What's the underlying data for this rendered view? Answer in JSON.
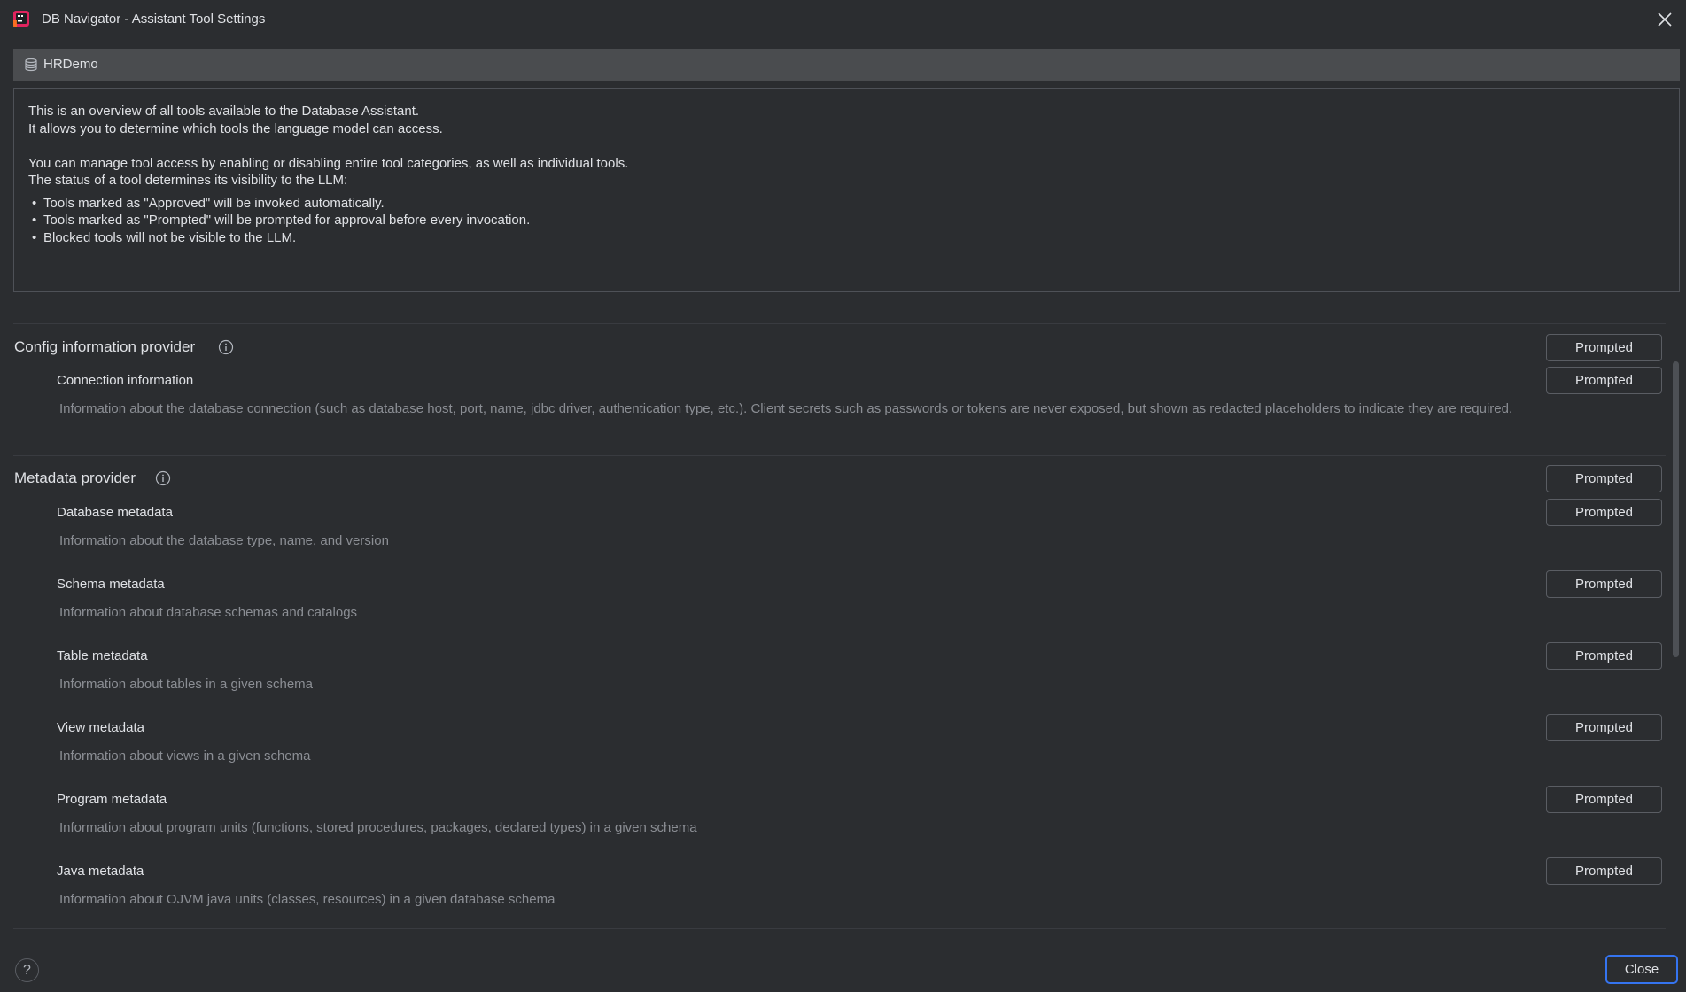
{
  "window": {
    "title": "DB Navigator - Assistant Tool Settings",
    "logo_icon": "db-navigator-logo-icon",
    "close_icon": "close-icon"
  },
  "connection": {
    "name": "HRDemo",
    "icon": "database-icon"
  },
  "intro": {
    "line1": "This is an overview of all tools available to the Database Assistant.",
    "line2": "It allows you to determine which tools the language model can access.",
    "line3": "You can manage tool access by enabling or disabling entire tool categories, as well as individual tools.",
    "line4": "The status of a tool determines its visibility to the LLM:",
    "bullets": [
      "Tools marked as \"Approved\" will be invoked automatically.",
      "Tools marked as \"Prompted\" will be prompted for approval before every invocation.",
      "Blocked tools will not be visible to the LLM."
    ]
  },
  "categories": [
    {
      "title": "Config information provider",
      "status": "Prompted",
      "tools": [
        {
          "name": "Connection information",
          "status": "Prompted",
          "description": "Information about the database connection (such as database host, port, name, jdbc driver, authentication type, etc.). Client secrets such as passwords or tokens are never exposed, but shown as redacted placeholders to indicate they are required."
        }
      ]
    },
    {
      "title": "Metadata provider",
      "status": "Prompted",
      "tools": [
        {
          "name": "Database metadata",
          "status": "Prompted",
          "description": "Information about the database type, name, and version"
        },
        {
          "name": "Schema metadata",
          "status": "Prompted",
          "description": "Information about database schemas and catalogs"
        },
        {
          "name": "Table metadata",
          "status": "Prompted",
          "description": "Information about tables in a given schema"
        },
        {
          "name": "View metadata",
          "status": "Prompted",
          "description": "Information about views in a given schema"
        },
        {
          "name": "Program metadata",
          "status": "Prompted",
          "description": "Information about program units (functions, stored procedures, packages, declared types) in a given schema"
        },
        {
          "name": "Java metadata",
          "status": "Prompted",
          "description": "Information about OJVM java units (classes, resources) in a given database schema"
        }
      ]
    }
  ],
  "footer": {
    "help_label": "?",
    "close_label": "Close"
  },
  "colors": {
    "background": "#2b2d30",
    "header_bar": "#4a4c4f",
    "accent": "#3574f0",
    "muted_text": "#8b8e94"
  }
}
